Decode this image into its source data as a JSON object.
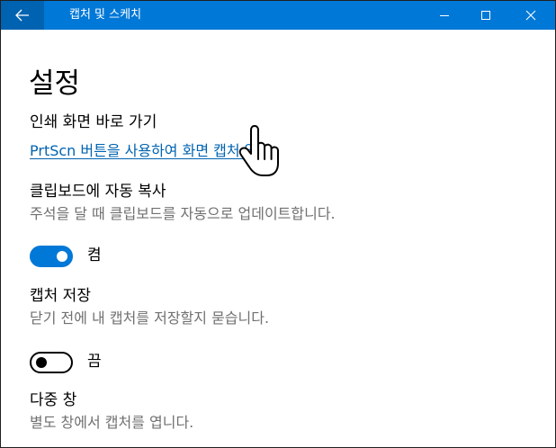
{
  "window": {
    "title": "캡처 및 스케치"
  },
  "titlebar": {
    "back_icon": "back-arrow-icon",
    "minimize_icon": "minimize-icon",
    "maximize_icon": "maximize-icon",
    "close_icon": "close-icon",
    "accent_color": "#0078d7"
  },
  "page": {
    "heading": "설정",
    "shortcut": {
      "label": "인쇄 화면 바로 가기",
      "link": "PrtScn 버튼을 사용하여 화면 캡처 열기"
    },
    "clipboard": {
      "label": "클립보드에 자동 복사",
      "description": "주석을 달 때 클립보드를 자동으로 업데이트합니다.",
      "toggle_state": "on",
      "toggle_label": "켬"
    },
    "save_capture": {
      "label": "캡처 저장",
      "description": "닫기 전에 내 캡처를 저장할지 묻습니다.",
      "toggle_state": "off",
      "toggle_label": "끔"
    },
    "multi_window": {
      "label": "다중 창",
      "description": "별도 창에서 캡처를 엽니다."
    }
  },
  "cursor": {
    "icon": "hand-pointer-icon"
  }
}
